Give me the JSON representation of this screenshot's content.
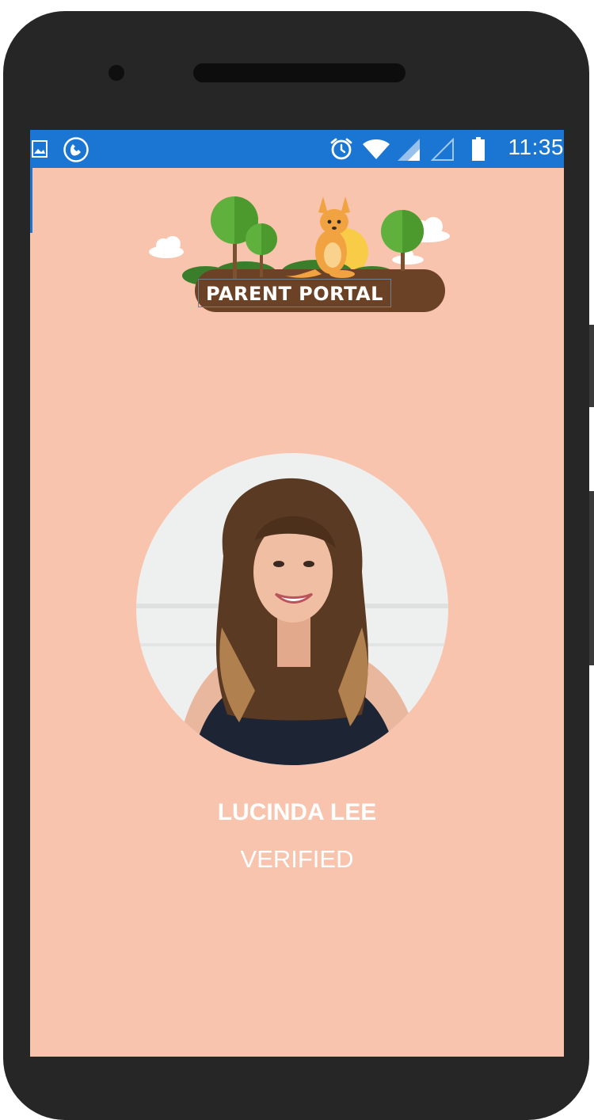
{
  "status_bar": {
    "time": "11:35",
    "icons": [
      "gallery-icon",
      "call-icon",
      "alarm-icon",
      "wifi-icon",
      "signal-icon",
      "signal-empty-icon",
      "battery-icon"
    ]
  },
  "app": {
    "logo_text": "PARENT PORTAL"
  },
  "profile": {
    "name": "LUCINDA LEE",
    "status": "VERIFIED"
  },
  "colors": {
    "background": "#f8c4ae",
    "status_bar": "#1a76d2",
    "phone_body": "#262626",
    "logo_log": "#6b4226"
  }
}
